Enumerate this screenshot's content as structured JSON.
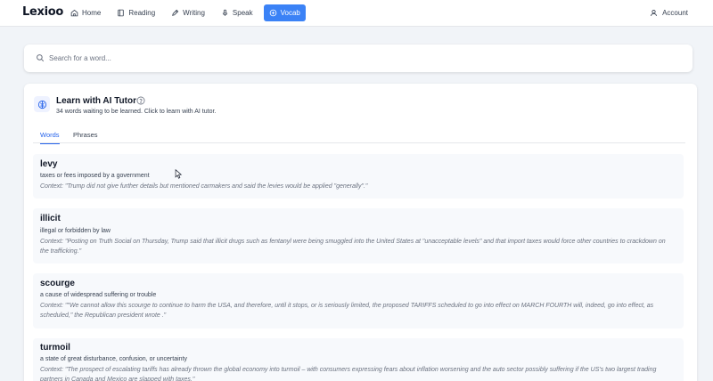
{
  "app": {
    "logo": "Lexioo"
  },
  "nav": {
    "items": [
      {
        "label": "Home",
        "icon": "home-icon"
      },
      {
        "label": "Reading",
        "icon": "book-icon"
      },
      {
        "label": "Writing",
        "icon": "pencil-icon"
      },
      {
        "label": "Speak",
        "icon": "microphone-icon"
      },
      {
        "label": "Vocab",
        "icon": "vocab-icon",
        "active": true
      }
    ],
    "account_label": "Account",
    "accent_color": "#3b82f6"
  },
  "search": {
    "placeholder": "Search for a word..."
  },
  "tutor": {
    "title": "Learn with AI Tutor",
    "subtitle": "34 words waiting to be learned. Click to learn with AI tutor."
  },
  "tabs": {
    "words": "Words",
    "phrases": "Phrases",
    "active": "Words"
  },
  "words": [
    {
      "term": "levy",
      "definition": "taxes or fees imposed by a government",
      "context": "Context: \"Trump did not give further details but mentioned carmakers and said the levies would be applied \"generally\".\""
    },
    {
      "term": "illicit",
      "definition": "illegal or forbidden by law",
      "context": "Context: \"Posting on Truth Social on Thursday, Trump said that illicit drugs such as fentanyl were being smuggled into the United States at \"unacceptable levels\" and that import taxes would force other countries to crackdown on the trafficking.\""
    },
    {
      "term": "scourge",
      "definition": "a cause of widespread suffering or trouble",
      "context": "Context: \"\"We cannot allow this scourge to continue to harm the USA, and therefore, until it stops, or is seriously limited, the proposed TARIFFS scheduled to go into effect on MARCH FOURTH will, indeed, go into effect, as scheduled,\" the Republican president wrote .\""
    },
    {
      "term": "turmoil",
      "definition": "a state of great disturbance, confusion, or uncertainty",
      "context": "Context: \"The prospect of escalating tariffs has already thrown the global economy into turmoil – with consumers expressing fears about inflation worsening and the auto sector possibly suffering if the US's two largest trading partners in Canada and Mexico are slapped with taxes.\""
    }
  ]
}
